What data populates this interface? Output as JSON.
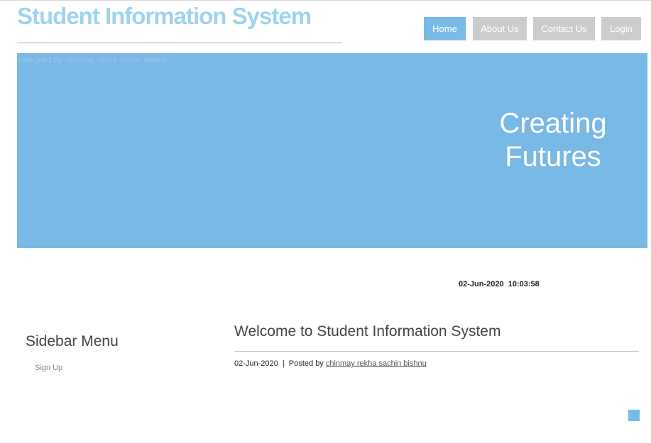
{
  "header": {
    "site_title": "Student Information System"
  },
  "nav": {
    "items": [
      {
        "label": "Home",
        "active": true
      },
      {
        "label": "About Us",
        "active": false
      },
      {
        "label": "Contact Us",
        "active": false
      },
      {
        "label": "Login",
        "active": false
      }
    ]
  },
  "banner": {
    "credit": "Designed by: chinmay rekha sachin bishnu",
    "tagline_line1": "Creating",
    "tagline_line2": "Futures"
  },
  "clock": {
    "datetime": "02-Jun-2020  10:03:58"
  },
  "sidebar": {
    "heading": "Sidebar Menu",
    "items": [
      {
        "label": "Sign Up"
      }
    ]
  },
  "post": {
    "title": "Welcome to Student Information System",
    "date": "02-Jun-2020",
    "separator": "|",
    "posted_by_prefix": "Posted by",
    "author": "chinmay rekha sachin bishnu"
  },
  "colors": {
    "accent": "#79b9e5",
    "title": "#9fd3f0",
    "nav_inactive": "#cccccc"
  }
}
